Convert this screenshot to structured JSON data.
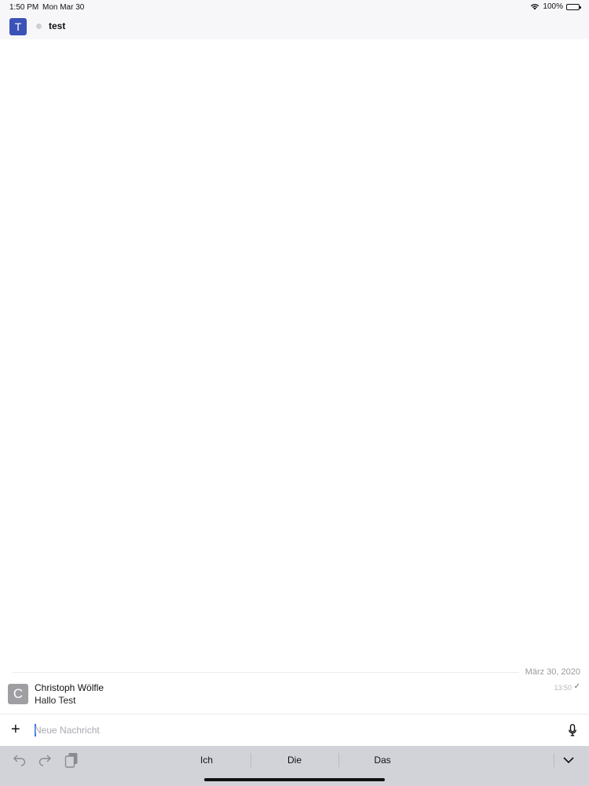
{
  "status_bar": {
    "time": "1:50 PM",
    "date": "Mon Mar 30",
    "battery": "100%"
  },
  "header": {
    "avatar_letter": "T",
    "room_name": "test",
    "accent": "#3b53b8"
  },
  "messages": {
    "date_divider": "März 30, 2020",
    "items": [
      {
        "avatar_letter": "C",
        "author": "Christoph Wölfle",
        "text": "Hallo Test",
        "time": "13:50"
      }
    ]
  },
  "composer": {
    "placeholder": "Neue Nachricht"
  },
  "keyboard": {
    "suggestions": [
      "Ich",
      "Die",
      "Das"
    ]
  },
  "icons": [
    "wifi-icon",
    "battery-icon",
    "plus-icon",
    "mic-icon",
    "undo-icon",
    "redo-icon",
    "paste-icon",
    "chevron-down-icon",
    "checkmark-icon"
  ]
}
